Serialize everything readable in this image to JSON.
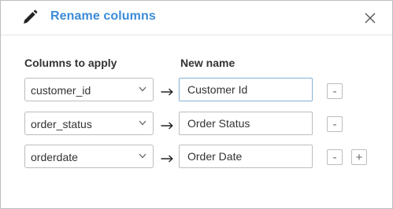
{
  "dialog": {
    "title": "Rename columns",
    "icons": {
      "title": "pencil-icon",
      "close": "close-icon"
    }
  },
  "columns": {
    "apply_header": "Columns to apply",
    "name_header": "New name"
  },
  "rows": [
    {
      "column": "customer_id",
      "new_name": "Customer Id",
      "remove_label": "-"
    },
    {
      "column": "order_status",
      "new_name": "Order Status",
      "remove_label": "-"
    },
    {
      "column": "orderdate",
      "new_name": "Order Date",
      "remove_label": "-",
      "add_label": "+"
    }
  ],
  "colors": {
    "title": "#3d8bd6",
    "border": "#bdbdbd"
  }
}
